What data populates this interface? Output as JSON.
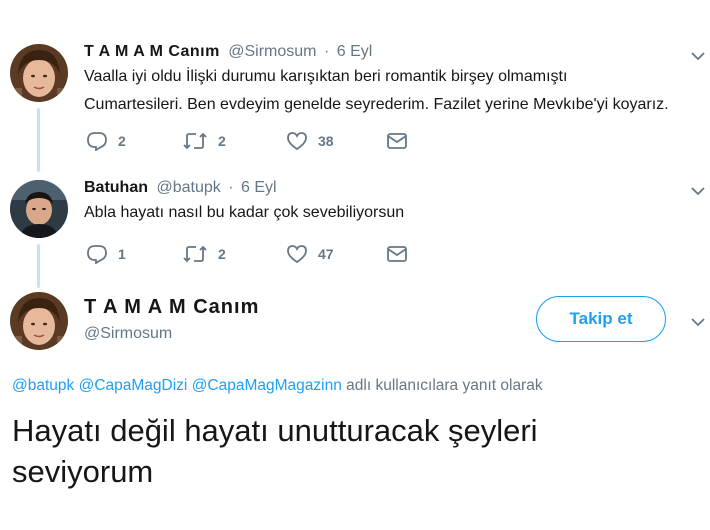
{
  "tweet1": {
    "name": "T A M A M Canım",
    "handle": "@Sirmosum",
    "separator": "·",
    "date": "6 Eyl",
    "text_line1": "Vaalla iyi oldu İlişki durumu karışıktan beri romantik birşey olmamıştı",
    "text_line2": "Cumartesileri. Ben evdeyim genelde seyrederim. Fazilet yerine Mevkıbe'yi koyarız.",
    "replies": "2",
    "retweets": "2",
    "likes": "38"
  },
  "tweet2": {
    "name": "Batuhan",
    "handle": "@batupk",
    "separator": "·",
    "date": "6 Eyl",
    "text": "Abla hayatı nasıl bu kadar çok sevebiliyorsun",
    "replies": "1",
    "retweets": "2",
    "likes": "47"
  },
  "main_tweet": {
    "name": "T A M A M Canım",
    "handle": "@Sirmosum",
    "follow_label": "Takip et",
    "mentions": [
      "@batupk",
      "@CapaMagDizi",
      "@CapaMagMagazinn"
    ],
    "reply_suffix": "adlı kullanıcılara yanıt olarak",
    "text_line1": "Hayatı değil hayatı unutturacak şeyleri",
    "text_line2": "seviyorum"
  },
  "colors": {
    "accent": "#1da1f2",
    "muted": "#657786",
    "thread_line": "#c4e4f4"
  },
  "icons": [
    "reply-icon",
    "retweet-icon",
    "like-icon",
    "dm-icon",
    "chevron-down-icon"
  ]
}
